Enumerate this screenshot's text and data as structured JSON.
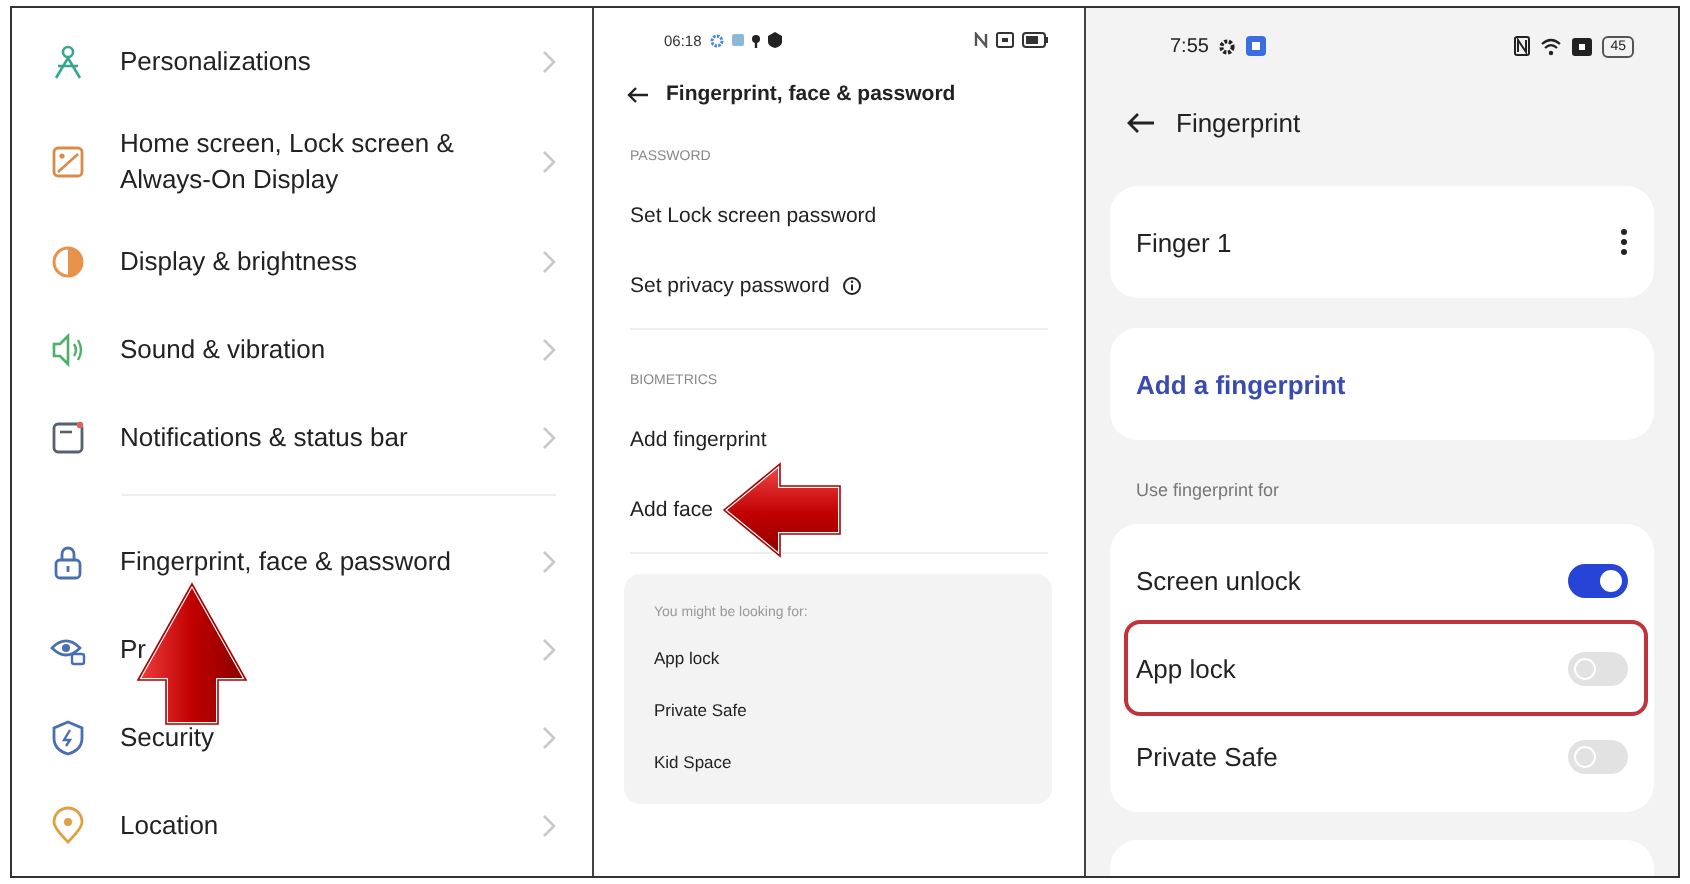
{
  "settings_list": {
    "annotations": [
      {
        "kind": "up"
      }
    ],
    "groups": [
      {
        "items": [
          {
            "label": "Personalizations"
          },
          {
            "label": "Home screen, Lock screen & Always-On Display"
          },
          {
            "label": "Display & brightness"
          },
          {
            "label": "Sound & vibration"
          },
          {
            "label": "Notifications & status bar"
          }
        ]
      },
      {
        "items": [
          {
            "label": "Fingerprint, face & password"
          },
          {
            "label": "Pr"
          },
          {
            "label": "Security"
          },
          {
            "label": "Location"
          }
        ]
      }
    ]
  },
  "password_screen": {
    "status_time": "06:18",
    "title": "Fingerprint, face & password",
    "sections": [
      {
        "heading": "PASSWORD",
        "items": [
          {
            "label": "Set Lock screen password",
            "info": false,
            "arrow": false
          },
          {
            "label": "Set privacy password",
            "info": true,
            "arrow": false
          }
        ]
      },
      {
        "heading": "BIOMETRICS",
        "items": [
          {
            "label": "Add fingerprint",
            "info": false,
            "arrow": false
          },
          {
            "label": "Add face",
            "info": false,
            "arrow": true
          }
        ]
      }
    ],
    "suggestions": {
      "title": "You might be looking for:",
      "items": [
        "App lock",
        "Private Safe",
        "Kid Space"
      ]
    }
  },
  "fingerprint_screen": {
    "status_time": "7:55",
    "battery": "45",
    "title": "Fingerprint",
    "finger": "Finger 1",
    "add_link": "Add a fingerprint",
    "section_label": "Use fingerprint for",
    "toggles": [
      {
        "label": "Screen unlock",
        "on": true,
        "highlighted": false
      },
      {
        "label": "App lock",
        "on": false,
        "highlighted": true
      },
      {
        "label": "Private Safe",
        "on": false,
        "highlighted": false
      }
    ]
  }
}
